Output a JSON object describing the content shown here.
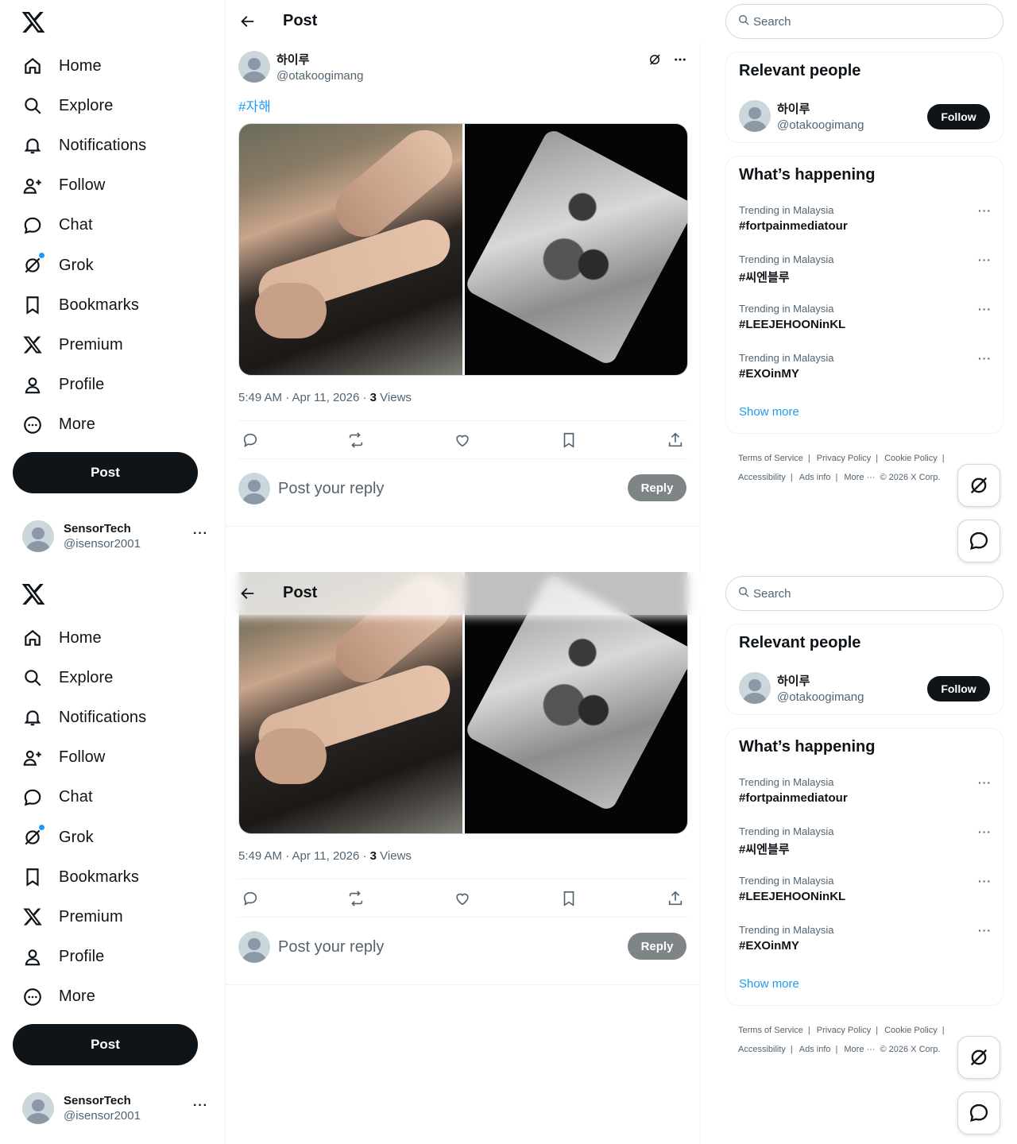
{
  "nav": {
    "items": [
      {
        "label": "Home",
        "icon": "home-icon"
      },
      {
        "label": "Explore",
        "icon": "search-icon"
      },
      {
        "label": "Notifications",
        "icon": "bell-icon"
      },
      {
        "label": "Follow",
        "icon": "person-add-icon"
      },
      {
        "label": "Chat",
        "icon": "chat-icon"
      },
      {
        "label": "Grok",
        "icon": "grok-icon"
      },
      {
        "label": "Bookmarks",
        "icon": "bookmark-icon"
      },
      {
        "label": "Premium",
        "icon": "x-logo-icon"
      },
      {
        "label": "Profile",
        "icon": "person-icon"
      },
      {
        "label": "More",
        "icon": "more-circle-icon"
      }
    ],
    "post_label": "Post"
  },
  "account": {
    "name": "SensorTech",
    "handle": "@isensor2001",
    "more": "···"
  },
  "header": {
    "title": "Post"
  },
  "tweet": {
    "author_name": "하이루",
    "author_handle": "@otakoogimang",
    "hashtag": "#자해",
    "time": "5:49 AM · Apr 11, 2026 · ",
    "views_count": "3",
    "views_label": " Views",
    "reply_placeholder": "Post your reply",
    "reply_button": "Reply"
  },
  "search": {
    "placeholder": "Search"
  },
  "relevant": {
    "title": "Relevant people",
    "name": "하이루",
    "handle": "@otakoogimang",
    "follow_label": "Follow"
  },
  "happening": {
    "title": "What’s happening",
    "trends": [
      {
        "context": "Trending in Malaysia",
        "tag": "#fortpainmediatour"
      },
      {
        "context": "Trending in Malaysia",
        "tag": "#씨엔블루"
      },
      {
        "context": "Trending in Malaysia",
        "tag": "#LEEJEHOONinKL"
      },
      {
        "context": "Trending in Malaysia",
        "tag": "#EXOinMY"
      }
    ],
    "show_more": "Show more",
    "trend_more": "···"
  },
  "footer": {
    "tos": "Terms of Service",
    "privacy": "Privacy Policy",
    "cookie": "Cookie Policy",
    "accessibility": "Accessibility",
    "ads": "Ads info",
    "more": "More ···",
    "copyright": "© 2026 X Corp."
  },
  "colors": {
    "accent": "#1d9bf0",
    "text": "#0f1419",
    "muted": "#536471"
  }
}
